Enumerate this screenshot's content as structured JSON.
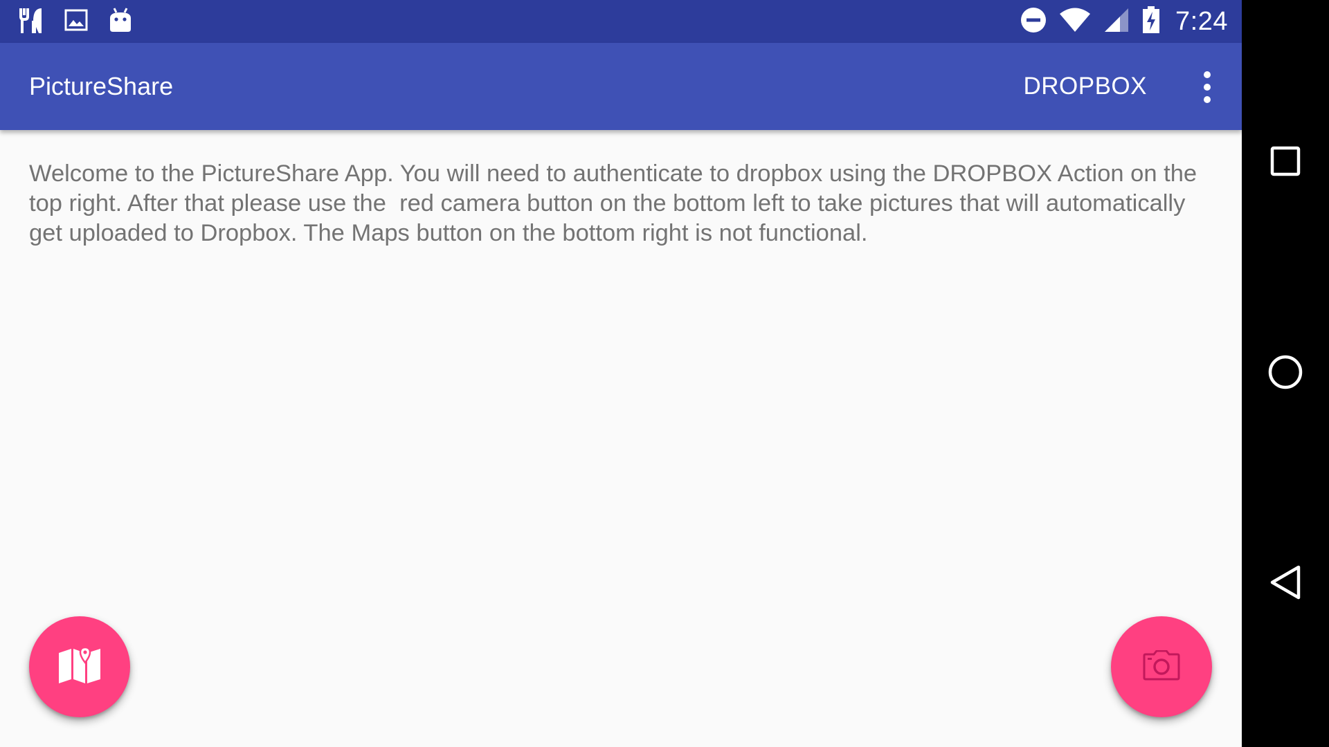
{
  "status_bar": {
    "time": "7:24",
    "left_icons": [
      "restaurant-icon",
      "image-icon",
      "android-icon"
    ],
    "right_icons": [
      "do-not-disturb-icon",
      "wifi-icon",
      "cell-signal-icon",
      "battery-charging-icon"
    ]
  },
  "app_bar": {
    "title": "PictureShare",
    "action_label": "DROPBOX",
    "overflow_icon": "more-vert-icon",
    "color": "#3f51b5"
  },
  "main": {
    "welcome_text": "Welcome to the PictureShare App. You will need to authenticate to dropbox using the DROPBOX Action on the top right. After that please use the  red camera button on the bottom left to take pictures that will automatically get uploaded to Dropbox. The Maps button on the bottom right is not functional."
  },
  "fabs": {
    "maps": {
      "icon": "map-icon",
      "color": "#ff4081"
    },
    "camera": {
      "icon": "camera-icon",
      "color": "#ff4081"
    }
  },
  "nav_bar": {
    "buttons": [
      "recents-icon",
      "home-icon",
      "back-icon"
    ]
  },
  "colors": {
    "status_bar": "#2d3c9b",
    "accent": "#ff4081",
    "background": "#fafafa",
    "body_text": "#737373"
  }
}
